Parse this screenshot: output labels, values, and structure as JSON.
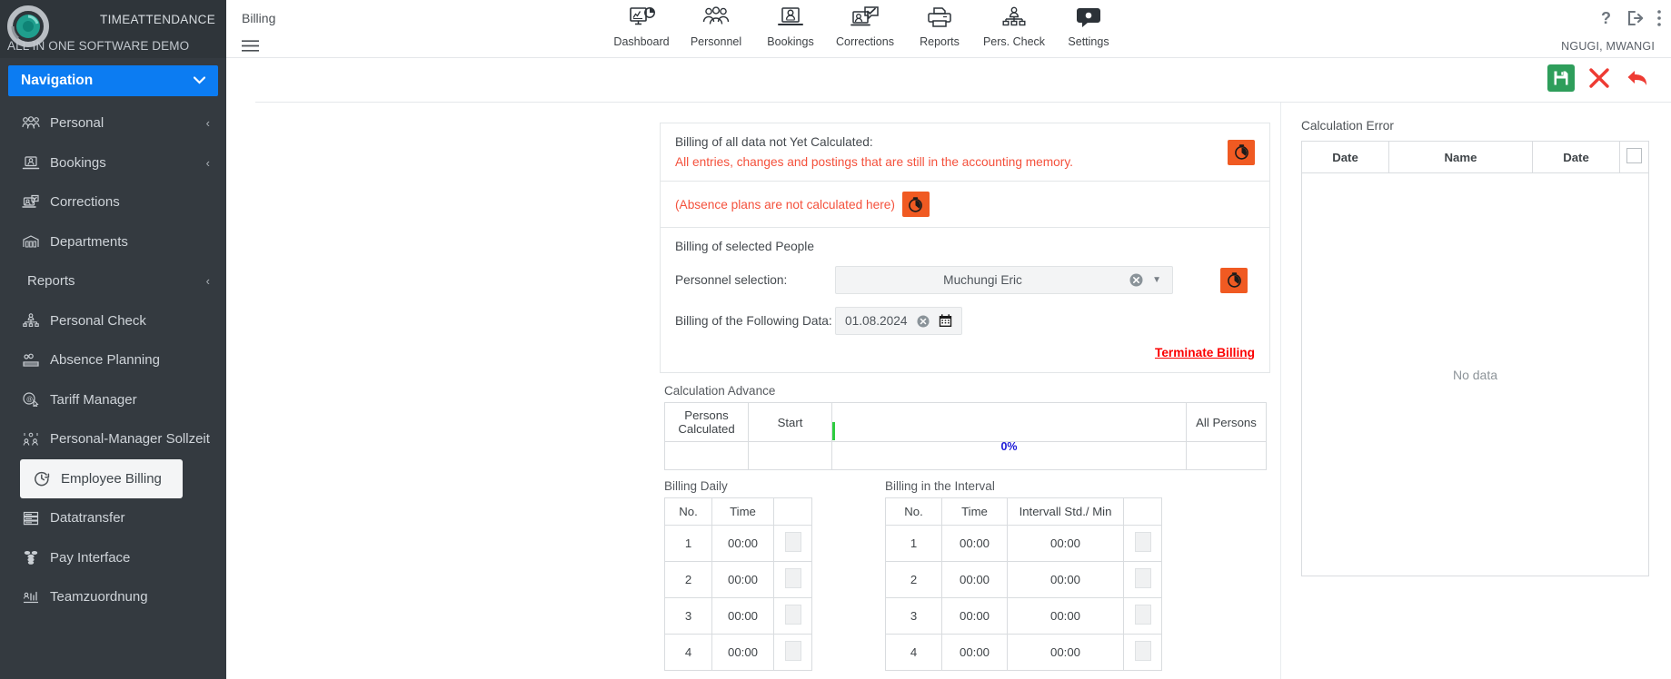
{
  "brand": {
    "title": "TIMEATTENDANCE",
    "subtitle": "ALL IN ONE SOFTWARE DEMO",
    "logo_icon": "clock-globe-logo"
  },
  "sidebar": {
    "nav_header": "Navigation",
    "nav_header_icon": "chevron-down-icon",
    "items": [
      {
        "label": "Personal",
        "icon": "group-people-icon",
        "chevron": "‹",
        "active": false
      },
      {
        "label": "Bookings",
        "icon": "laptop-user-icon",
        "chevron": "‹",
        "active": false
      },
      {
        "label": "Corrections",
        "icon": "laptop-check-icon",
        "chevron": "",
        "active": false
      },
      {
        "label": "Departments",
        "icon": "department-building-icon",
        "chevron": "",
        "active": false
      },
      {
        "label": "Reports",
        "icon": "",
        "chevron": "‹",
        "active": false
      },
      {
        "label": "Personal Check",
        "icon": "org-chart-icon",
        "chevron": "",
        "active": false
      },
      {
        "label": "Absence Planning",
        "icon": "calendar-absence-icon",
        "chevron": "",
        "active": false
      },
      {
        "label": "Tariff Manager",
        "icon": "tariff-cursor-icon",
        "chevron": "",
        "active": false
      },
      {
        "label": "Personal-Manager Sollzeit",
        "icon": "people-arrows-icon",
        "chevron": "",
        "active": false
      },
      {
        "label": "Employee Billing",
        "icon": "clock-refresh-icon",
        "chevron": "",
        "active": true
      },
      {
        "label": "Datatransfer",
        "icon": "server-transfer-icon",
        "chevron": "",
        "active": false
      },
      {
        "label": "Pay Interface",
        "icon": "coins-icon",
        "chevron": "",
        "active": false
      },
      {
        "label": "Teamzuordnung",
        "icon": "team-assign-icon",
        "chevron": "",
        "active": false
      }
    ]
  },
  "topbar": {
    "breadcrumb": "Billing",
    "menu_icon": "hamburger-menu-icon",
    "tabs": [
      {
        "label": "Dashboard",
        "icon": "dashboard-monitor-icon"
      },
      {
        "label": "Personnel",
        "icon": "personnel-group-icon"
      },
      {
        "label": "Bookings",
        "icon": "bookings-laptop-icon"
      },
      {
        "label": "Corrections",
        "icon": "corrections-check-icon"
      },
      {
        "label": "Reports",
        "icon": "printer-icon"
      },
      {
        "label": "Pers. Check",
        "icon": "org-chart-icon"
      },
      {
        "label": "Settings",
        "icon": "settings-gear-icon"
      }
    ],
    "help_icon": "question-mark-icon",
    "logout_icon": "logout-arrow-icon",
    "more_icon": "vertical-dots-icon",
    "username": "NGUGI, MWANGI"
  },
  "actionbar": {
    "save_icon": "save-disk-icon",
    "cancel_icon": "red-x-icon",
    "back_icon": "red-undo-arrow-icon",
    "colors": {
      "save_bg": "#2e9e5b",
      "cancel": "#ee3b33",
      "back": "#ee3b33"
    }
  },
  "billing": {
    "not_calculated_title": "Billing of all data not Yet Calculated:",
    "not_calculated_note": "All entries, changes and postings that are still in the accounting memory.",
    "absence_note": "(Absence plans are not calculated here)",
    "run_icon": "orange-timer-icon",
    "selected_people_title": "Billing of selected People",
    "personnel_label": "Personnel selection:",
    "personnel_value": "Muchungi Eric",
    "clear_icon": "clear-circle-x-icon",
    "dropdown_icon": "caret-down-icon",
    "date_label": "Billing of the Following Data:",
    "date_value": "01.08.2024",
    "calendar_icon": "calendar-icon",
    "terminate_label": "Terminate Billing",
    "terminate_color": "#fb0000"
  },
  "calculation_advance": {
    "caption": "Calculation Advance",
    "headers": [
      "Persons Calculated",
      "Start",
      "",
      "All Persons"
    ],
    "header_persons_line1": "Persons",
    "header_persons_line2": "Calculated",
    "header_start": "Start",
    "header_all_persons": "All Persons",
    "progress_text": "0%",
    "progress_value": 0,
    "progress_color": "#2ecc40",
    "row_values": [
      "",
      "",
      "",
      ""
    ]
  },
  "billing_daily": {
    "caption": "Billing Daily",
    "headers": [
      "No.",
      "Time",
      ""
    ],
    "rows": [
      {
        "no": "1",
        "time": "00:00"
      },
      {
        "no": "2",
        "time": "00:00"
      },
      {
        "no": "3",
        "time": "00:00"
      },
      {
        "no": "4",
        "time": "00:00"
      }
    ]
  },
  "billing_interval": {
    "caption": "Billing in the Interval",
    "headers": [
      "No.",
      "Time",
      "Intervall Std./ Min",
      ""
    ],
    "rows": [
      {
        "no": "1",
        "time": "00:00",
        "interval": "00:00"
      },
      {
        "no": "2",
        "time": "00:00",
        "interval": "00:00"
      },
      {
        "no": "3",
        "time": "00:00",
        "interval": "00:00"
      },
      {
        "no": "4",
        "time": "00:00",
        "interval": "00:00"
      }
    ]
  },
  "calculation_error": {
    "title": "Calculation Error",
    "headers": [
      "Date",
      "Name",
      "Date",
      ""
    ],
    "empty_text": "No data",
    "rows": []
  }
}
